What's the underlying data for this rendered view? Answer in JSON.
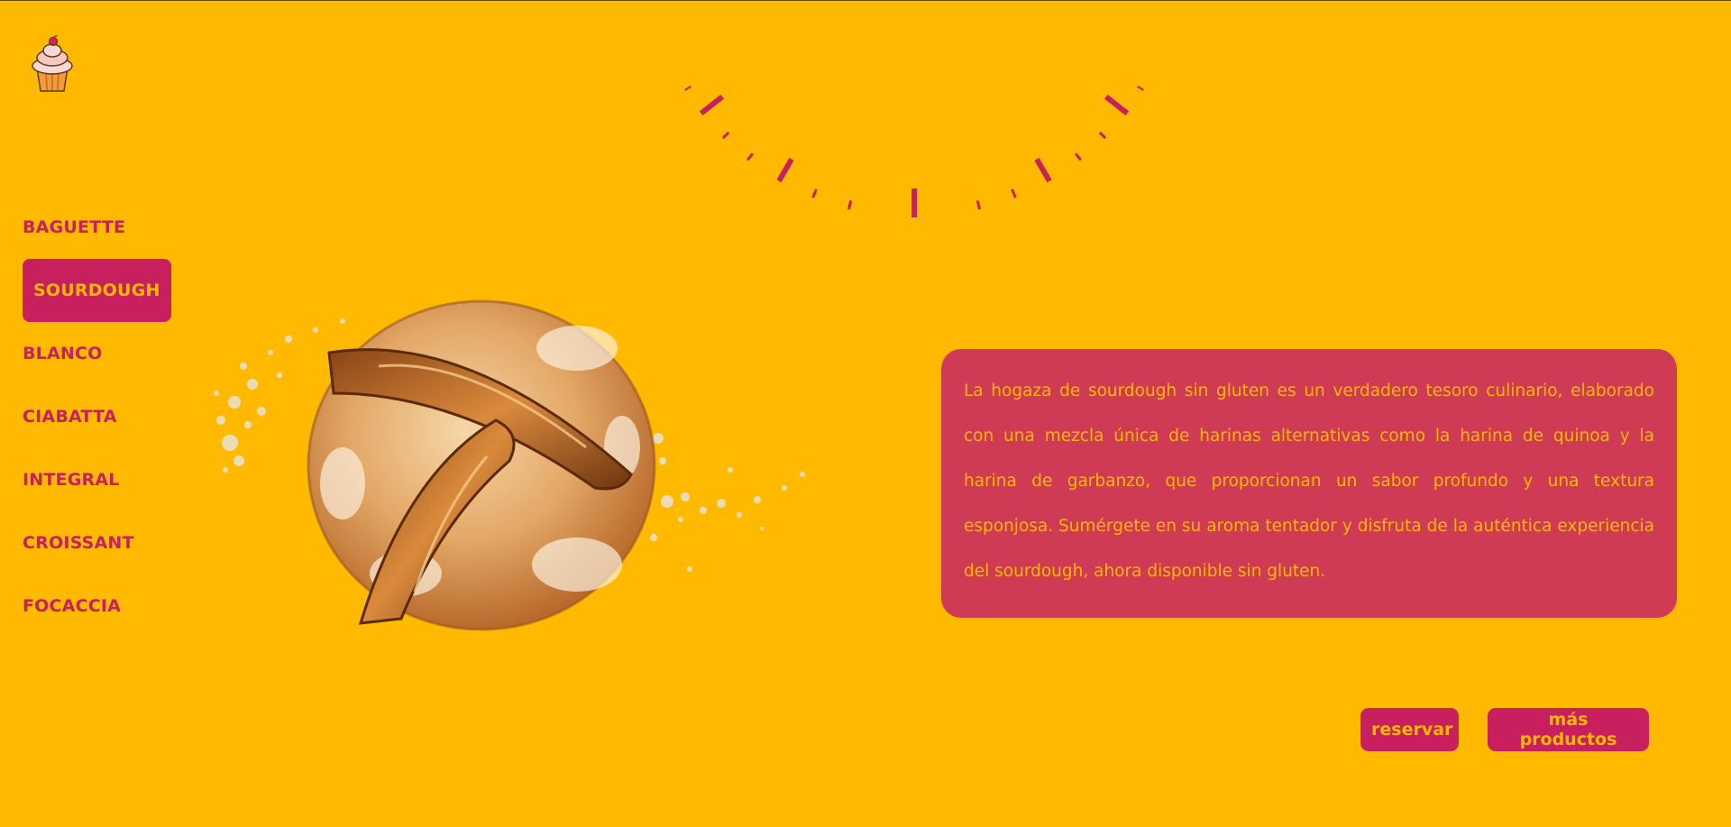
{
  "brand": {
    "logo_icon": "cupcake-icon"
  },
  "colors": {
    "background": "#FFBA00",
    "accent": "#C8205F",
    "panel": "#CF3A55"
  },
  "nav": {
    "items": [
      {
        "label": "BAGUETTE"
      },
      {
        "label": "SOURDOUGH"
      },
      {
        "label": "BLANCO"
      },
      {
        "label": "CIABATTA"
      },
      {
        "label": "INTEGRAL"
      },
      {
        "label": "CROISSANT"
      },
      {
        "label": "FOCACCIA"
      }
    ],
    "active": "SOURDOUGH"
  },
  "product": {
    "image_icon": "sourdough-bread-image",
    "description": "La hogaza de sourdough sin gluten es un verdadero tesoro culinario, elaborado con una mezcla única de harinas alternativas como la harina de quinoa y la harina de garbanzo, que proporcionan un sabor profundo y una textura esponjosa. Sumérgete en su aroma tentador y disfruta de la auténtica experiencia del sourdough, ahora disponible sin gluten."
  },
  "actions": {
    "reserve_label": "reservar",
    "more_label": "más productos"
  }
}
